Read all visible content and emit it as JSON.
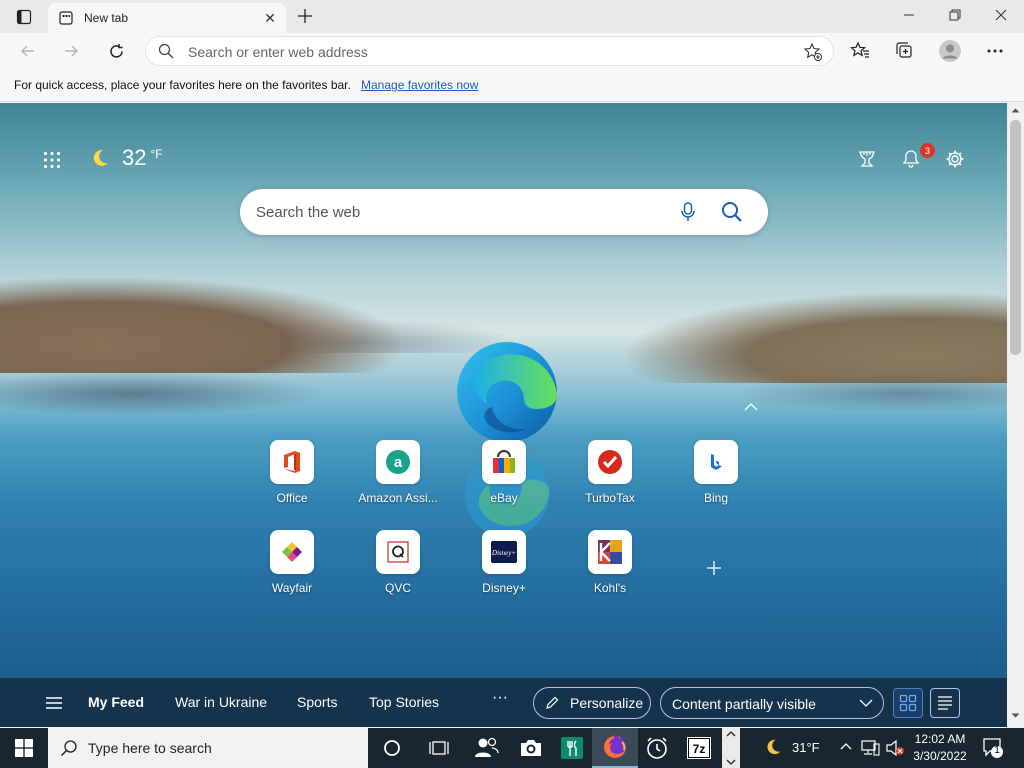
{
  "browser": {
    "tab": {
      "title": "New tab",
      "close": "✕"
    },
    "address_placeholder": "Search or enter web address",
    "favorites_bar": {
      "message": "For quick access, place your favorites here on the favorites bar.",
      "link": "Manage favorites now"
    }
  },
  "newtab": {
    "weather": {
      "icon": "moon-icon",
      "temperature": "32",
      "unit": "°F"
    },
    "notifications_count": "3",
    "search_placeholder": "Search the web",
    "quick_links": [
      {
        "label": "Office",
        "icon": "office-icon"
      },
      {
        "label": "Amazon Assi...",
        "icon": "amazon-assistant-icon"
      },
      {
        "label": "eBay",
        "icon": "ebay-icon"
      },
      {
        "label": "TurboTax",
        "icon": "turbotax-icon"
      },
      {
        "label": "Bing",
        "icon": "bing-icon"
      },
      {
        "label": "Wayfair",
        "icon": "wayfair-icon"
      },
      {
        "label": "QVC",
        "icon": "qvc-icon"
      },
      {
        "label": "Disney+",
        "icon": "disney-plus-icon"
      },
      {
        "label": "Kohl's",
        "icon": "kohls-icon"
      }
    ],
    "feed": {
      "items": [
        "My Feed",
        "War in Ukraine",
        "Sports",
        "Top Stories"
      ],
      "more": "···",
      "personalize": "Personalize",
      "content_visibility": "Content partially visible"
    }
  },
  "taskbar": {
    "search_placeholder": "Type here to search",
    "weather": {
      "icon": "moon-icon",
      "temperature": "31°F"
    },
    "clock": {
      "time": "12:02 AM",
      "date": "3/30/2022"
    },
    "notification_count": "1",
    "pinned": [
      "task-view",
      "people",
      "camera",
      "restaurant-app",
      "firefox",
      "alarms-clock",
      "7zip"
    ]
  },
  "colors": {
    "feed_bar": "#16334d",
    "taskbar": "#19252f",
    "link": "#1a5fb4",
    "badge": "#d9362b"
  }
}
